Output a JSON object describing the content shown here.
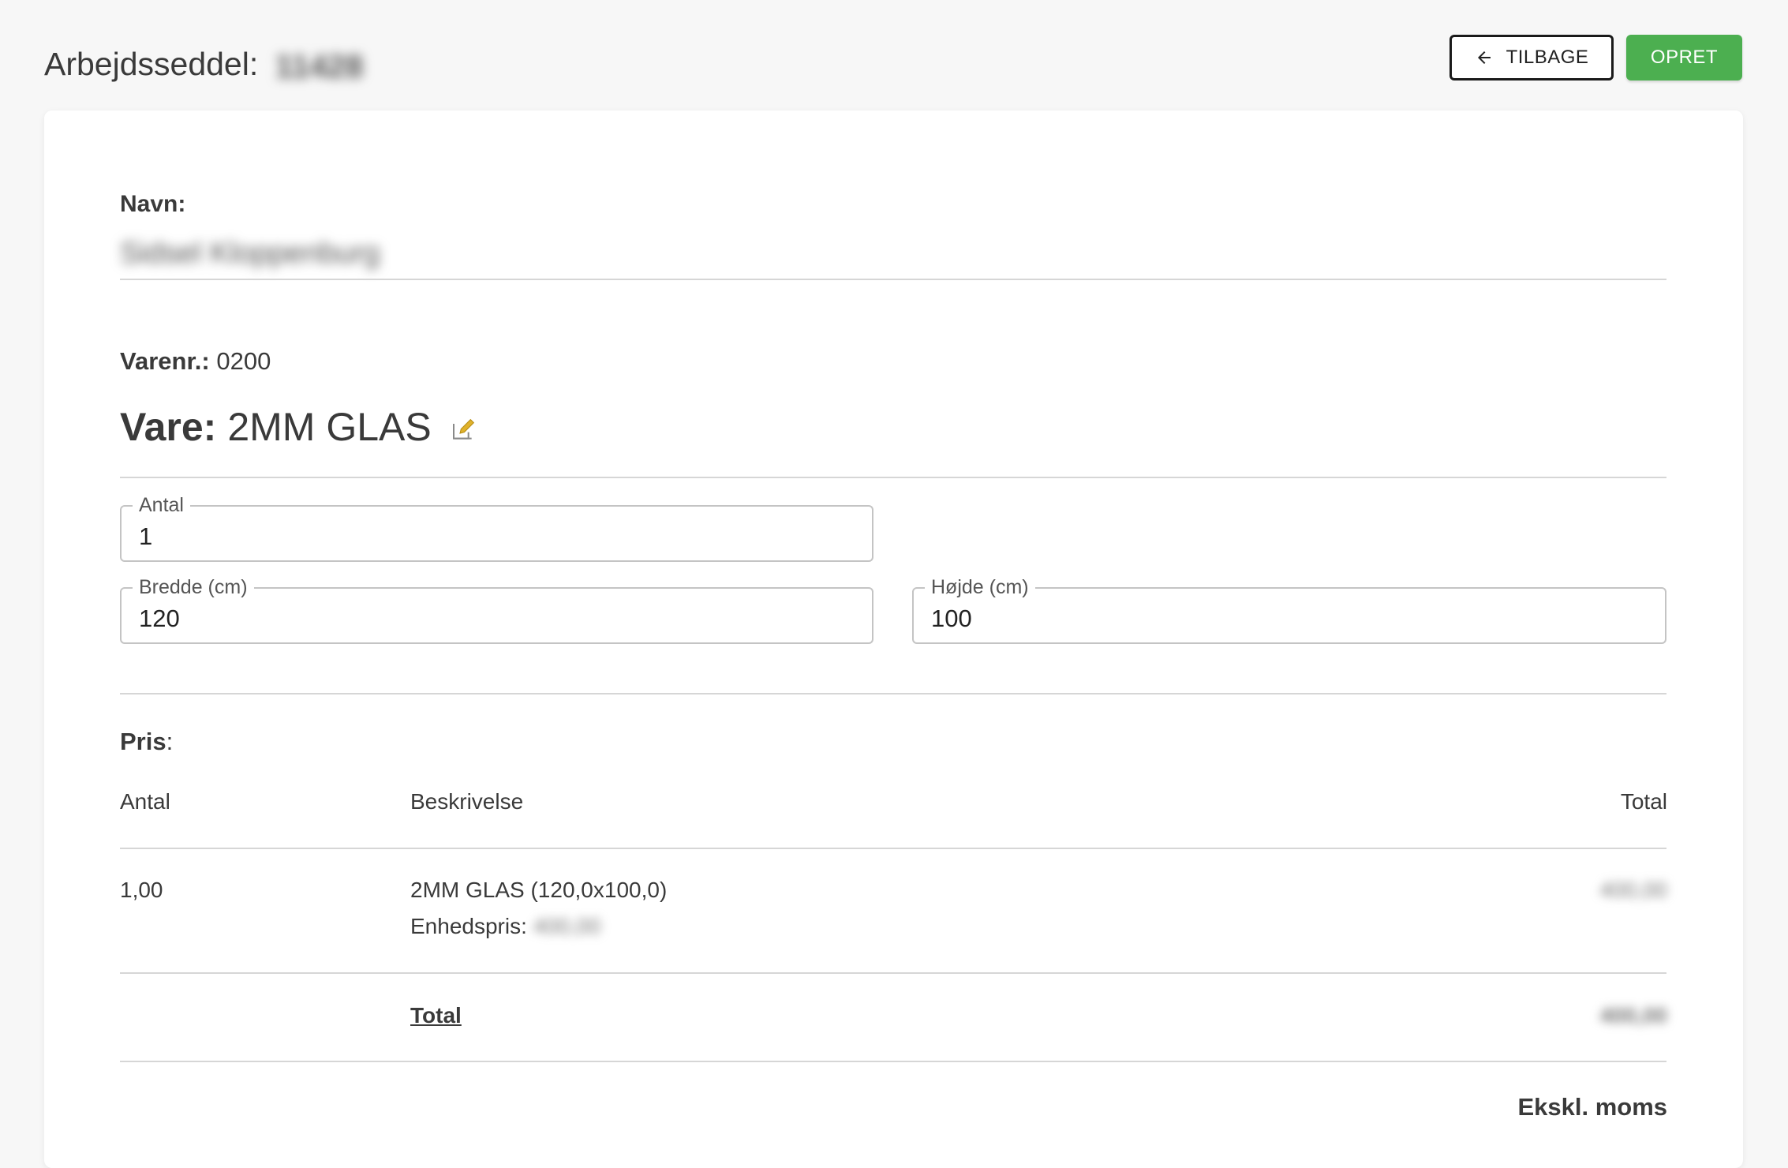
{
  "header": {
    "title": "Arbejdsseddel:",
    "title_id": "11428",
    "back_label": "TILBAGE",
    "create_label": "OPRET"
  },
  "form": {
    "name_label": "Navn:",
    "name_value": "Sidsel Kloppenburg",
    "varenr_label": "Varenr.:",
    "varenr_value": "0200",
    "vare_label": "Vare:",
    "vare_value": "2MM GLAS",
    "antal": {
      "label": "Antal",
      "value": "1"
    },
    "bredde": {
      "label": "Bredde (cm)",
      "value": "120"
    },
    "hoejde": {
      "label": "Højde (cm)",
      "value": "100"
    }
  },
  "pris": {
    "label": "Pris",
    "colon": ":",
    "columns": [
      "Antal",
      "Beskrivelse",
      "Total"
    ],
    "rows": [
      {
        "antal": "1,00",
        "description": "2MM GLAS (120,0x100,0)",
        "unit_price_label": "Enhedspris:",
        "unit_price": "400,00",
        "total": "400,00"
      }
    ],
    "total_label": "Total",
    "total_value": "400,00",
    "footer_note": "Ekskl. moms"
  },
  "colors": {
    "accent_green": "#4caf50",
    "edit_icon": "#e0b22c"
  }
}
